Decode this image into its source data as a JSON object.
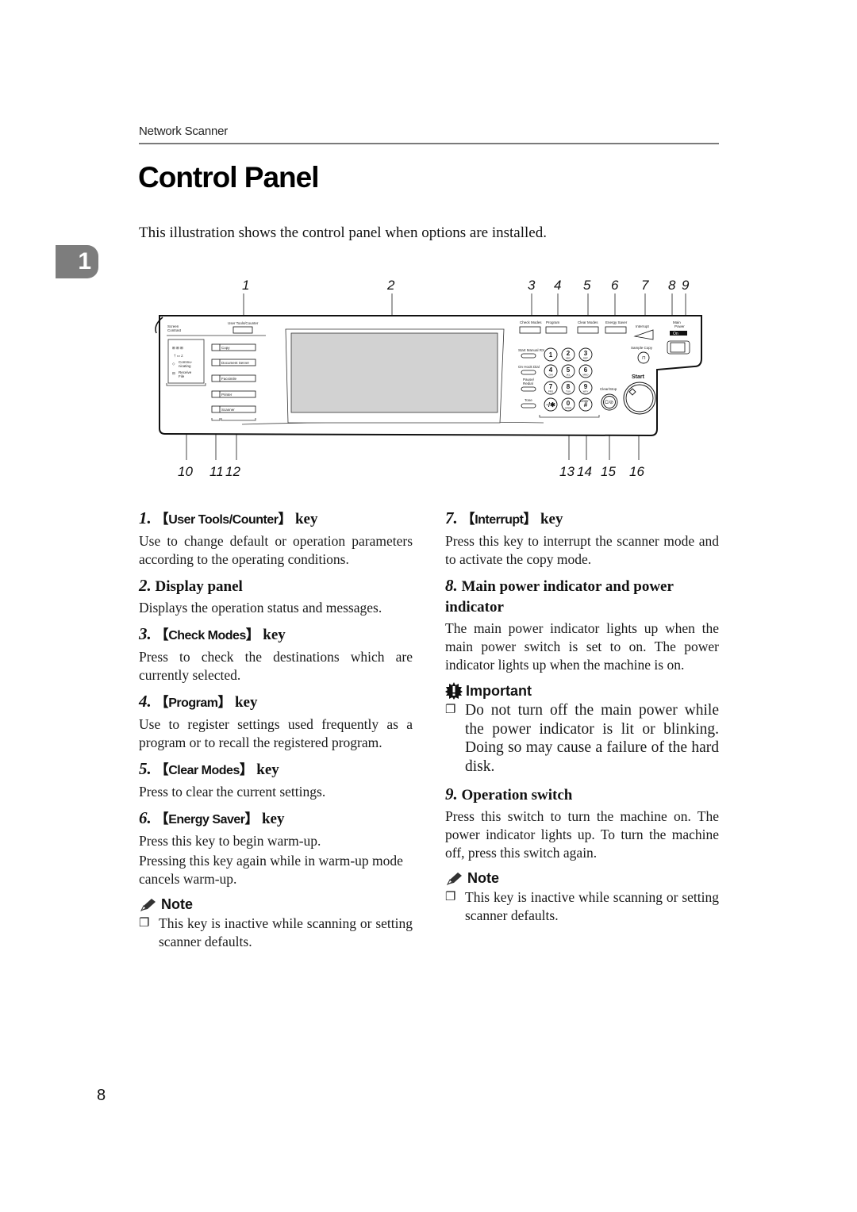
{
  "header": {
    "section": "Network Scanner"
  },
  "page": {
    "title": "Control Panel",
    "intro": "This illustration shows the control panel when options are installed.",
    "chapter_tab": "1",
    "page_number": "8"
  },
  "figure": {
    "callouts_top": [
      "1",
      "2",
      "3",
      "4",
      "5",
      "6",
      "7",
      "8",
      "9"
    ],
    "callouts_bottom": [
      "10",
      "11",
      "12",
      "13",
      "14",
      "15",
      "16"
    ],
    "panel_labels": {
      "screen_contrast": [
        "Screen",
        "Contrast"
      ],
      "user_tools": "User Tools/Counter",
      "mode_keys": [
        "Copy",
        "Document Server",
        "Facsimile",
        "Printer",
        "Scanner"
      ],
      "indicators": [
        "Commu-",
        "nicating",
        "Receive",
        "File"
      ],
      "top_keys": [
        "Check Modes",
        "Program",
        "Clear Modes",
        "Energy Saver",
        "Interrupt"
      ],
      "main_power": [
        "Main",
        "Power"
      ],
      "on_label": "On",
      "fax_keys": [
        "Start Manual RX",
        "On Hook Dial",
        "Pause/",
        "Redial",
        "Tone"
      ],
      "keypad": [
        {
          "digit": "1",
          "letters": ""
        },
        {
          "digit": "2",
          "letters": "ABC"
        },
        {
          "digit": "3",
          "letters": "DEF"
        },
        {
          "digit": "4",
          "letters": "GHI"
        },
        {
          "digit": "5",
          "letters": "JKL"
        },
        {
          "digit": "6",
          "letters": "MNO"
        },
        {
          "digit": "7",
          "letters": "PRS"
        },
        {
          "digit": "8",
          "letters": "TUV"
        },
        {
          "digit": "9",
          "letters": "WXY"
        },
        {
          "digit": "·/✱",
          "letters": ""
        },
        {
          "digit": "0",
          "letters": "OPER"
        },
        {
          "digit": "#",
          "letters": ""
        }
      ],
      "enter": "Enter",
      "sample_copy": "Sample Copy",
      "clear_stop": "Clear/Stop",
      "clear_stop_glyph": "C/⊘",
      "start": "Start"
    }
  },
  "items_left": [
    {
      "num": "1.",
      "key": "User Tools/Counter",
      "suffix": "key",
      "body": "Use to change default or operation parameters according to the operating conditions."
    },
    {
      "num": "2.",
      "title": "Display panel",
      "body": "Displays the operation status and messages."
    },
    {
      "num": "3.",
      "key": "Check Modes",
      "suffix": "key",
      "body": "Press to check the destinations which are currently selected."
    },
    {
      "num": "4.",
      "key": "Program",
      "suffix": "key",
      "body": "Use to register settings used frequently as a program or to recall the registered program."
    },
    {
      "num": "5.",
      "key": "Clear Modes",
      "suffix": "key",
      "body": "Press to clear the current settings."
    },
    {
      "num": "6.",
      "key": "Energy Saver",
      "suffix": "key",
      "body": "Press this key to begin warm-up.",
      "body2": "Pressing this key again while in warm-up mode cancels warm-up."
    }
  ],
  "note_left": {
    "title": "Note",
    "bullet": "This key is inactive while scanning or setting scanner defaults."
  },
  "items_right": [
    {
      "num": "7.",
      "key": "Interrupt",
      "suffix": "key",
      "body": "Press this key to interrupt the scanner mode and to activate the copy mode."
    },
    {
      "num": "8.",
      "title": "Main power indicator and power indicator",
      "body": "The main power indicator lights up when the main power switch is set to on. The power indicator lights up when the machine is on."
    },
    {
      "num": "9.",
      "title": "Operation switch",
      "body": "Press this switch to turn the machine on. The power indicator lights up. To turn the machine off, press this switch again."
    }
  ],
  "important": {
    "title": "Important",
    "bullet": "Do not turn off the main power while the power indicator is lit or blinking. Doing so may cause a failure of the hard disk."
  },
  "note_right": {
    "title": "Note",
    "bullet": "This key is inactive while scanning or setting scanner defaults."
  },
  "glyphs": {
    "bracket_open": "【",
    "bracket_close": "】",
    "checkbox": "❐"
  }
}
